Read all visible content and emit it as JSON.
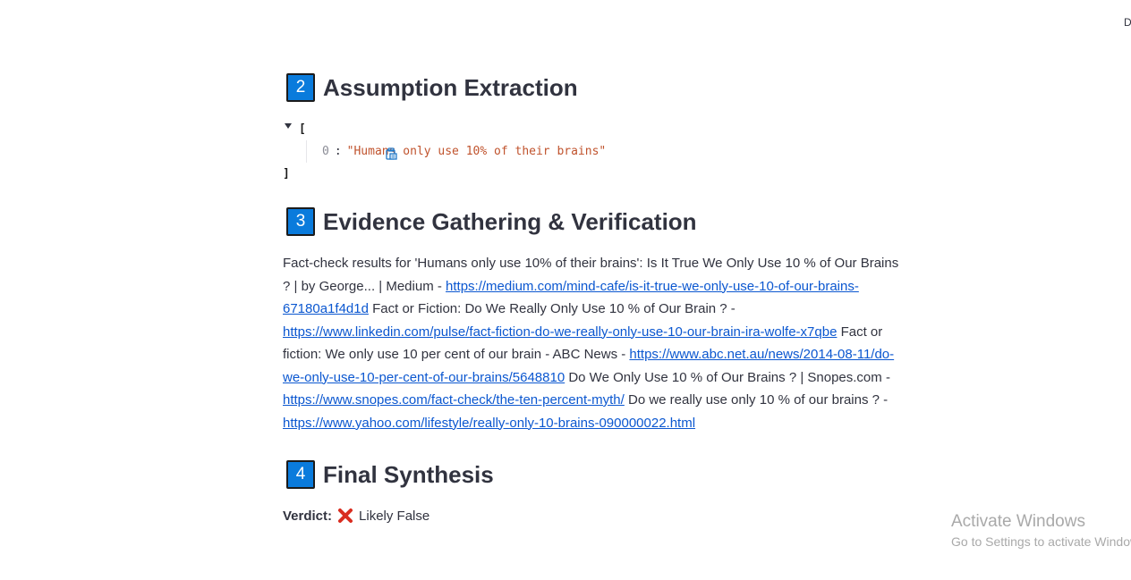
{
  "corner": {
    "glyph": "D"
  },
  "sections": {
    "assumption": {
      "number": "2",
      "title": "Assumption Extraction"
    },
    "evidence": {
      "number": "3",
      "title": "Evidence Gathering & Verification"
    },
    "synthesis": {
      "number": "4",
      "title": "Final Synthesis"
    }
  },
  "json_viewer": {
    "open_bracket": "[",
    "close_bracket": "]",
    "items": [
      {
        "index": "0",
        "value": "\"Humans only use 10% of their brains\""
      }
    ]
  },
  "evidence": {
    "intro": "Fact-check results for 'Humans only use 10% of their brains': Is It True We Only Use 10 % of Our Brains ? | by George... | Medium - ",
    "link1": "https://medium.com/mind-cafe/is-it-true-we-only-use-10-of-our-brains-67180a1f4d1d",
    "text2": " Fact or Fiction: Do We Really Only Use 10 % of Our Brain ? - ",
    "link2": "https://www.linkedin.com/pulse/fact-fiction-do-we-really-only-use-10-our-brain-ira-wolfe-x7qbe",
    "text3": " Fact or fiction: We only use 10 per cent of our brain - ABC News - ",
    "link3": "https://www.abc.net.au/news/2014-08-11/do-we-only-use-10-per-cent-of-our-brains/5648810",
    "text4": " Do We Only Use 10 % of Our Brains ? | Snopes.com - ",
    "link4": "https://www.snopes.com/fact-check/the-ten-percent-myth/",
    "text5": " Do we really use only 10 % of our brains ? - ",
    "link5": "https://www.yahoo.com/lifestyle/really-only-10-brains-090000022.html"
  },
  "verdict": {
    "label": "Verdict:",
    "value": "Likely False",
    "icon": "cross-mark-icon",
    "icon_color": "#d92d20"
  },
  "watermark": {
    "title": "Activate Windows",
    "subtitle": "Go to Settings to activate Windows."
  },
  "colors": {
    "badge": "#0a7bdc",
    "link": "#0b57d0",
    "json_string": "#c0532d"
  }
}
